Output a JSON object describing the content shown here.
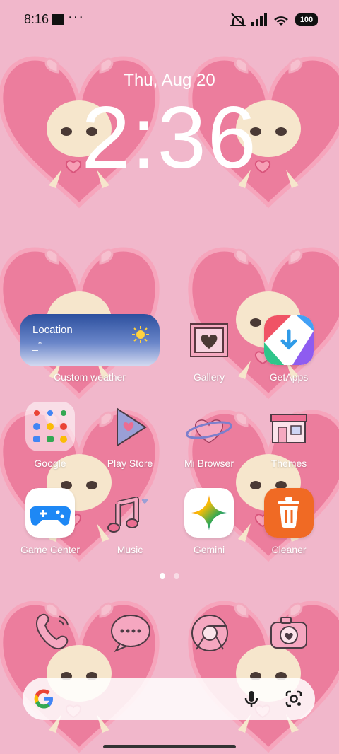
{
  "status_bar": {
    "time": "8:16",
    "overflow": "···",
    "battery": "100",
    "icons": [
      "notification-square-icon",
      "bell-muted-icon",
      "signal-icon",
      "wifi-icon",
      "battery-icon"
    ]
  },
  "clock": {
    "date": "Thu, Aug 20",
    "time": "2:36"
  },
  "weather_widget": {
    "location": "Location",
    "temperature": "_°",
    "label": "Custom weather",
    "icon": "sun-icon"
  },
  "apps": {
    "gallery": "Gallery",
    "getapps": "GetApps",
    "google": "Google",
    "playstore": "Play Store",
    "mibrowser": "Mi Browser",
    "themes": "Themes",
    "gamecenter": "Game Center",
    "music": "Music",
    "gemini": "Gemini",
    "cleaner": "Cleaner"
  },
  "dock_icons": [
    "phone-icon",
    "messages-icon",
    "chrome-icon",
    "camera-icon"
  ],
  "pager": {
    "pages": 2,
    "current": 1
  },
  "search_bar": {
    "icons": [
      "google-logo-icon",
      "mic-icon",
      "lens-icon"
    ]
  },
  "colors": {
    "wallpaper": "#f1b7cb",
    "heart": "#ec7d9d",
    "text": "#ffffff",
    "cleaner": "#f06a24"
  }
}
